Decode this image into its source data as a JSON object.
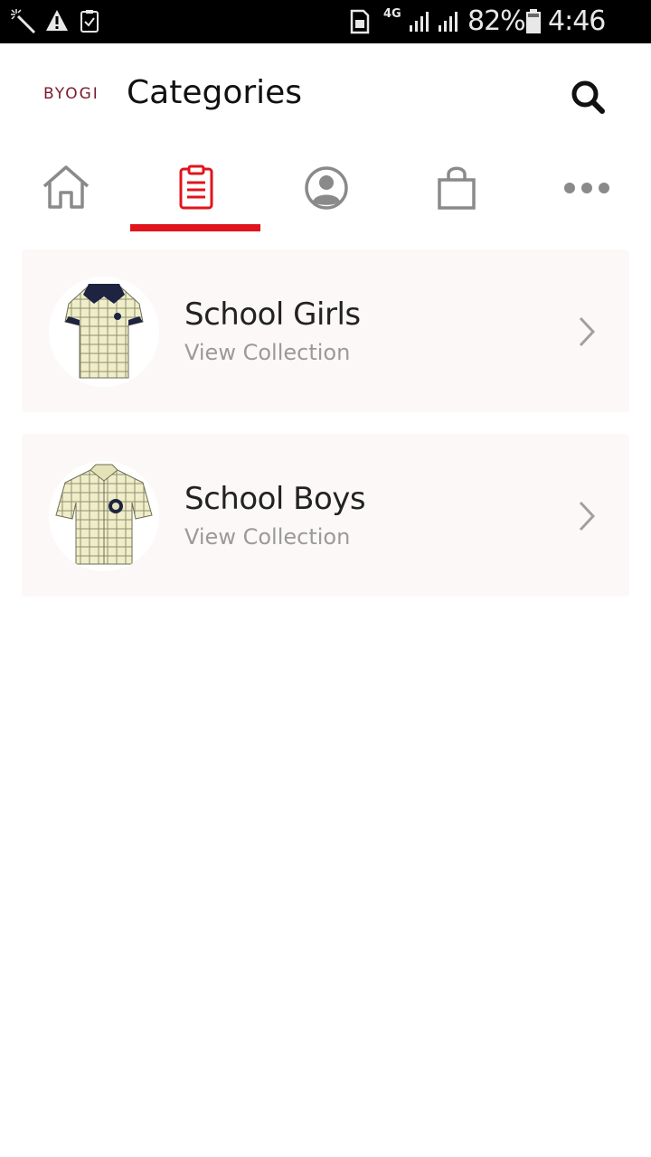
{
  "status_bar": {
    "network": "4G",
    "battery": "82%",
    "time": "4:46 pm",
    "icons": [
      "magic-wand-icon",
      "warning-icon",
      "clipboard-check-icon",
      "sim-card-icon",
      "signal-icon",
      "signal-icon",
      "battery-icon"
    ]
  },
  "header": {
    "brand": "BYOGI",
    "title": "Categories",
    "search_icon": "search-icon"
  },
  "tabs": [
    {
      "name": "home",
      "icon": "home-icon",
      "active": false
    },
    {
      "name": "categories",
      "icon": "clipboard-icon",
      "active": true
    },
    {
      "name": "account",
      "icon": "user-icon",
      "active": false
    },
    {
      "name": "cart",
      "icon": "shopping-bag-icon",
      "active": false
    },
    {
      "name": "more",
      "icon": "more-dots-icon",
      "active": false
    }
  ],
  "colors": {
    "accent": "#e0141c",
    "brand": "#7a1a2c",
    "card_bg": "#fdf8f8",
    "icon_gray": "#8a8a8a"
  },
  "categories": [
    {
      "title": "School Girls",
      "subtitle": "View Collection",
      "image": "girls-shirt-image"
    },
    {
      "title": "School Boys",
      "subtitle": "View Collection",
      "image": "boys-shirt-image"
    }
  ]
}
